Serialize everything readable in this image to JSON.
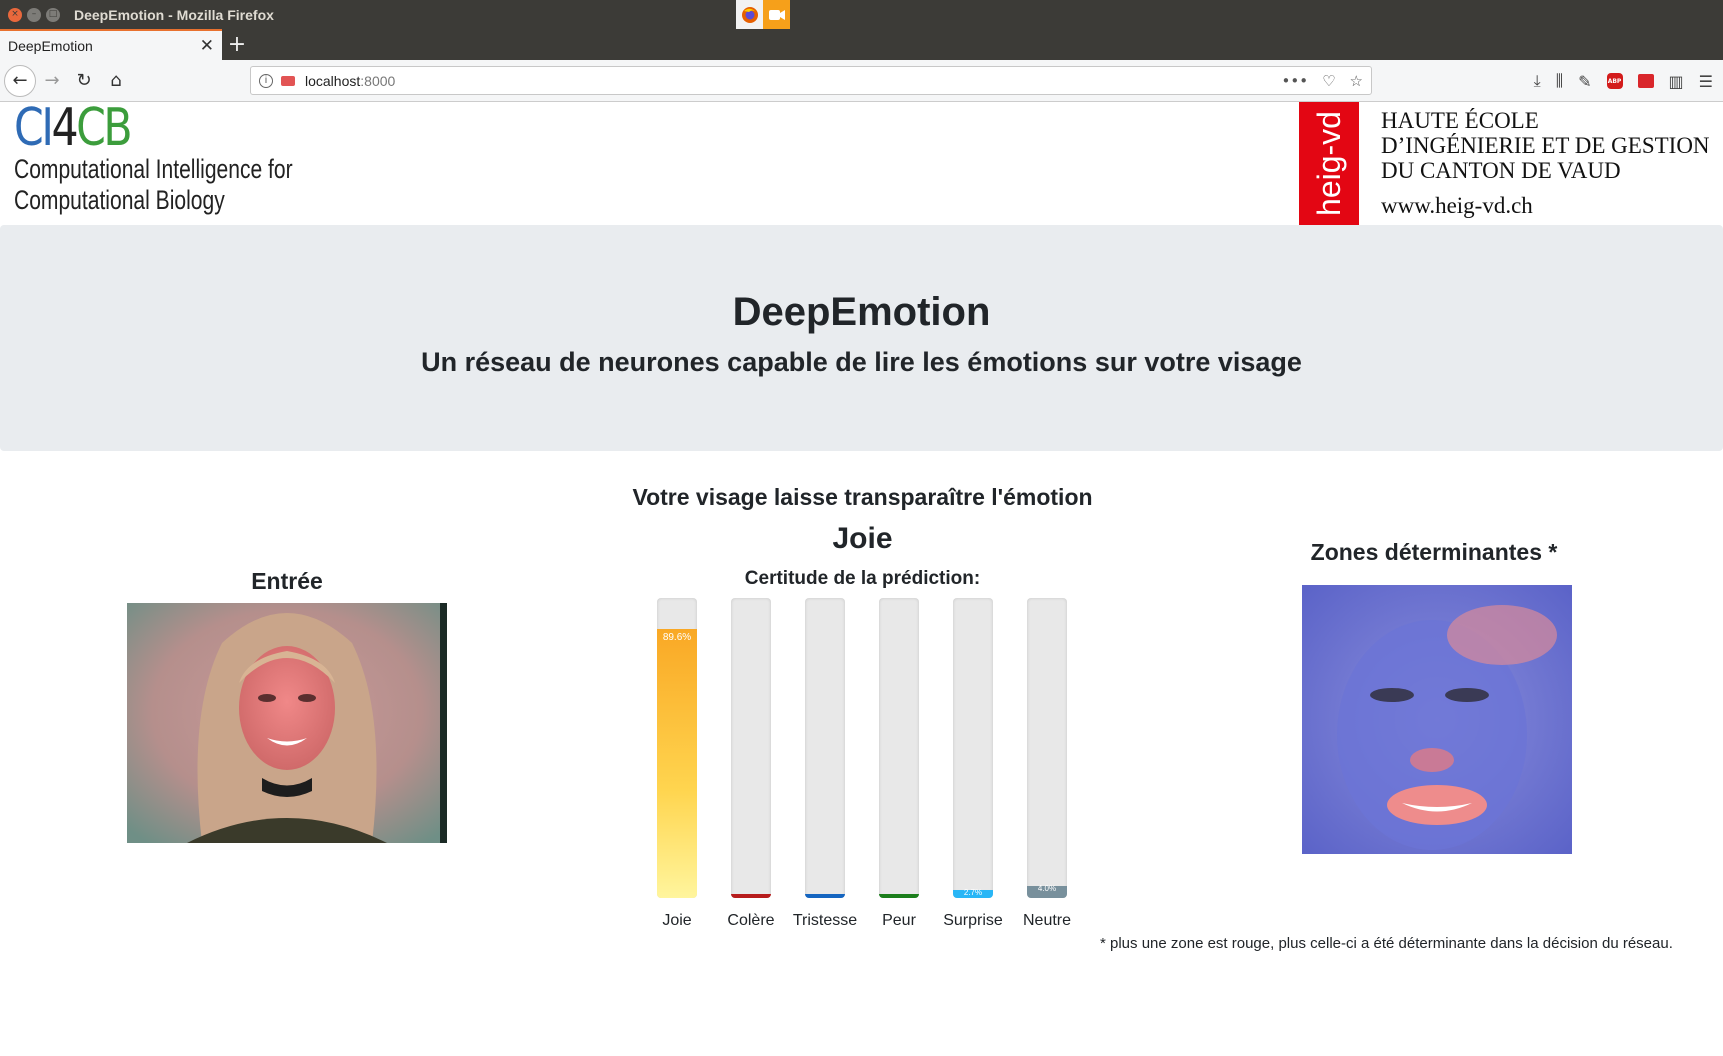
{
  "window": {
    "title": "DeepEmotion - Mozilla Firefox"
  },
  "tabs": [
    {
      "label": "DeepEmotion",
      "close": "✕"
    }
  ],
  "newtab_label": "+",
  "navbar": {
    "url_host": "localhost",
    "url_port": ":8000",
    "url_menu": "•••"
  },
  "logos": {
    "ci4cb_c": "CI",
    "ci4cb_4": "4",
    "ci4cb_b": "CB",
    "ci4cb_line1": "Computational Intelligence for",
    "ci4cb_line2": "Computational Biology",
    "heig_mark": "heig-vd",
    "heig_line1": "HAUTE ÉCOLE",
    "heig_line2": "D’INGÉNIERIE ET DE GESTION",
    "heig_line3": "DU CANTON DE VAUD",
    "heig_url": "www.heig-vd.ch"
  },
  "jumbotron": {
    "title": "DeepEmotion",
    "subtitle": "Un réseau de neurones capable de lire les émotions sur votre visage"
  },
  "result": {
    "intro": "Votre visage laisse transparaître l'émotion",
    "emotion": "Joie",
    "certainty_label": "Certitude de la prédiction:"
  },
  "input_panel": {
    "title": "Entrée"
  },
  "zones_panel": {
    "title": "Zones déterminantes *"
  },
  "chart_data": {
    "type": "bar",
    "categories": [
      "Joie",
      "Colère",
      "Tristesse",
      "Peur",
      "Surprise",
      "Neutre"
    ],
    "values": [
      89.6,
      0,
      0,
      0,
      2.7,
      4.0
    ],
    "value_labels": [
      "89.6%",
      "",
      "",
      "",
      "2.7%",
      "4.0%"
    ],
    "colors": [
      "#f9a825",
      "#b71c1c",
      "#1565c0",
      "#1b7e1b",
      "#29b6f6",
      "#78909c"
    ],
    "ylim": [
      0,
      100
    ]
  },
  "footnote": "* plus une zone est rouge, plus celle-ci a été déterminante dans la décision du réseau."
}
